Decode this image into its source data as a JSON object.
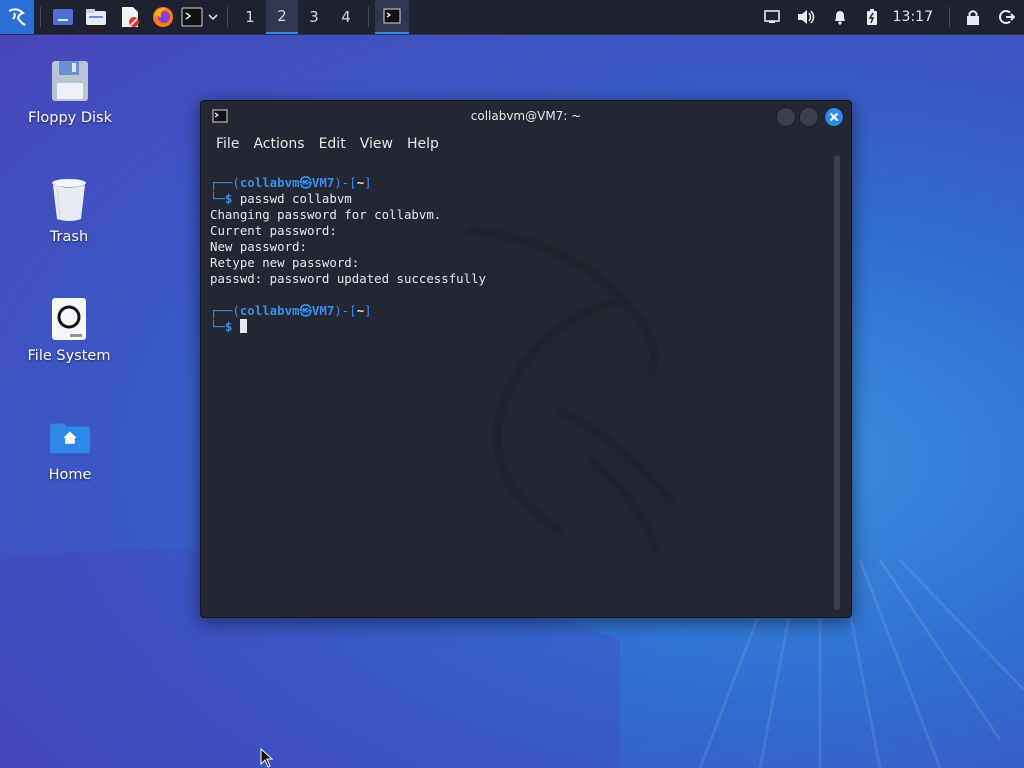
{
  "panel": {
    "workspaces": [
      {
        "label": "1",
        "active": false
      },
      {
        "label": "2",
        "active": true
      },
      {
        "label": "3",
        "active": false
      },
      {
        "label": "4",
        "active": false
      }
    ],
    "clock": "13:17",
    "icons": [
      "kali-menu-icon",
      "show-desktop-icon",
      "file-manager-icon",
      "text-editor-icon",
      "firefox-icon",
      "terminal-icon",
      "dropdown-icon",
      "network-icon",
      "volume-icon",
      "notification-icon",
      "battery-icon",
      "lock-icon",
      "logout-icon"
    ]
  },
  "desktop": {
    "icons": [
      {
        "label": "Floppy Disk"
      },
      {
        "label": "Trash"
      },
      {
        "label": "File System"
      },
      {
        "label": "Home"
      }
    ]
  },
  "terminal": {
    "title": "collabvm@VM7: ~",
    "menu": [
      "File",
      "Actions",
      "Edit",
      "View",
      "Help"
    ],
    "user": "collabvm",
    "at": "㉿",
    "host": "VM7",
    "dir": "~",
    "command": "passwd collabvm",
    "output": [
      "Changing password for collabvm.",
      "Current password:",
      "New password:",
      "Retype new password:",
      "passwd: password updated successfully"
    ]
  },
  "colors": {
    "accent": "#2f87e8",
    "panel": "#1e2230",
    "terminal_bg": "#232733",
    "prompt_blue": "#3a8fe6"
  }
}
